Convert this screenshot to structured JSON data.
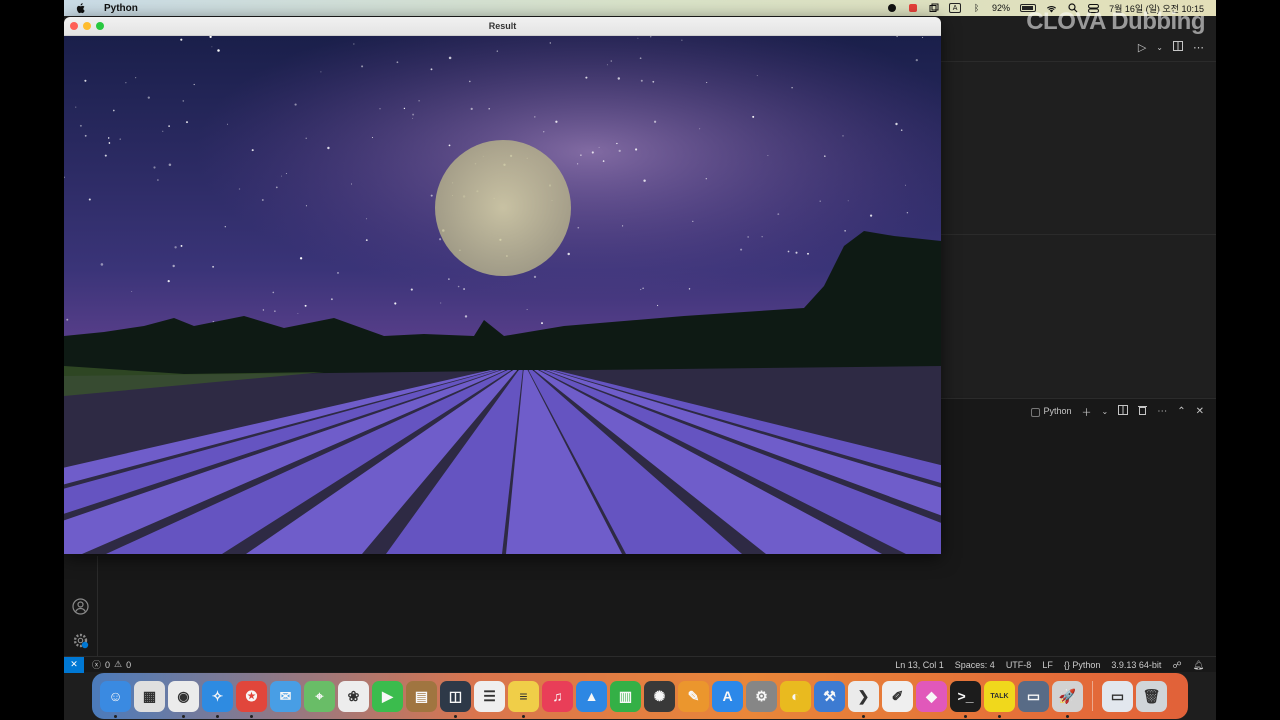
{
  "menubar": {
    "app_name": "Python",
    "battery": "92%",
    "clock": "7월 16일 (일) 오전 10:15",
    "input_source": "A"
  },
  "result_window": {
    "title": "Result"
  },
  "terminal": {
    "label": "Python"
  },
  "statusbar": {
    "errors": "0",
    "warnings": "0",
    "cursor": "Ln 13, Col 1",
    "spaces": "Spaces: 4",
    "encoding": "UTF-8",
    "eol": "LF",
    "language": "Python",
    "interpreter": "3.9.13 64-bit"
  },
  "dock": {
    "items": [
      {
        "name": "finder",
        "color": "#3b8ee8",
        "glyph": "☺"
      },
      {
        "name": "launchpad",
        "color": "#e6e6e6",
        "glyph": "▦"
      },
      {
        "name": "chrome",
        "color": "#f2f2f2",
        "glyph": "◉"
      },
      {
        "name": "safari",
        "color": "#2f8fe8",
        "glyph": "✧"
      },
      {
        "name": "app-red",
        "color": "#e8483c",
        "glyph": "✪"
      },
      {
        "name": "mail",
        "color": "#4aa3ec",
        "glyph": "✉"
      },
      {
        "name": "maps",
        "color": "#6cc36a",
        "glyph": "⌖"
      },
      {
        "name": "photos",
        "color": "#f4f4f4",
        "glyph": "❀"
      },
      {
        "name": "facetime",
        "color": "#3cc24f",
        "glyph": "▶"
      },
      {
        "name": "app-brown",
        "color": "#a57842",
        "glyph": "▤"
      },
      {
        "name": "app-dark",
        "color": "#2f3a4a",
        "glyph": "◫"
      },
      {
        "name": "reminders",
        "color": "#f6f6f6",
        "glyph": "☰"
      },
      {
        "name": "notes",
        "color": "#f7d44a",
        "glyph": "≡"
      },
      {
        "name": "music",
        "color": "#f0405a",
        "glyph": "♫"
      },
      {
        "name": "keynote",
        "color": "#2e8bea",
        "glyph": "▲"
      },
      {
        "name": "numbers",
        "color": "#35b548",
        "glyph": "▥"
      },
      {
        "name": "davinci",
        "color": "#3a3a3a",
        "glyph": "✺"
      },
      {
        "name": "pages",
        "color": "#f29a2e",
        "glyph": "✎"
      },
      {
        "name": "app-store",
        "color": "#2d8cf0",
        "glyph": "A"
      },
      {
        "name": "settings",
        "color": "#8a8a8a",
        "glyph": "⚙"
      },
      {
        "name": "app-yellow",
        "color": "#f0c020",
        "glyph": "◐"
      },
      {
        "name": "xcode",
        "color": "#3f7fd8",
        "glyph": "⚒"
      },
      {
        "name": "vscode",
        "color": "#f2f2f2",
        "glyph": "❯"
      },
      {
        "name": "textedit",
        "color": "#f6f6f6",
        "glyph": "✐"
      },
      {
        "name": "color-app",
        "color": "#e85ac0",
        "glyph": "◆"
      },
      {
        "name": "terminal",
        "color": "#1c1c1c",
        "glyph": ">_"
      },
      {
        "name": "kakaotalk",
        "color": "#f7df1c",
        "glyph": "TALK"
      },
      {
        "name": "preview",
        "color": "#5a6e8a",
        "glyph": "▭"
      },
      {
        "name": "python-launcher",
        "color": "#d8d8d8",
        "glyph": "🚀"
      }
    ],
    "trailing": [
      {
        "name": "downloads-folder",
        "color": "#e9eef5",
        "glyph": "▭"
      },
      {
        "name": "trash",
        "color": "#d6dbe0",
        "glyph": "🗑"
      }
    ]
  },
  "watermark": "CLOVA Dubbing"
}
